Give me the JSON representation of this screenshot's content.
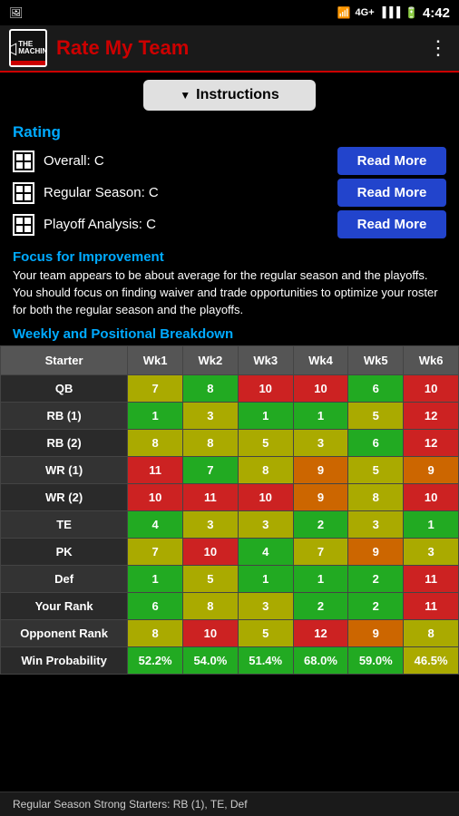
{
  "statusBar": {
    "time": "4:42",
    "wifi": "WiFi",
    "lte": "4G+",
    "battery": "Battery"
  },
  "header": {
    "logoLine1": "THE",
    "logoLine2": "MACHINE",
    "title": "Rate My Team",
    "menuIcon": "⋮"
  },
  "instructions": {
    "label": "Instructions",
    "arrow": "▼"
  },
  "rating": {
    "title": "Rating",
    "rows": [
      {
        "label": "Overall: C",
        "btnLabel": "Read More"
      },
      {
        "label": "Regular Season: C",
        "btnLabel": "Read More"
      },
      {
        "label": "Playoff Analysis: C",
        "btnLabel": "Read More"
      }
    ]
  },
  "focus": {
    "title": "Focus for Improvement",
    "text": "Your team appears to be about average for the regular season and the playoffs. You should focus on finding waiver and trade opportunities to optimize your roster for both the regular season and the playoffs."
  },
  "breakdown": {
    "title": "Weekly and Positional Breakdown"
  },
  "table": {
    "headers": [
      "Starter",
      "Wk1",
      "Wk2",
      "Wk3",
      "Wk4",
      "Wk5",
      "Wk6"
    ],
    "rows": [
      {
        "pos": "QB",
        "vals": [
          "7",
          "8",
          "10",
          "10",
          "6",
          "10"
        ],
        "colors": [
          "yellow",
          "green",
          "red",
          "red",
          "green",
          "red"
        ]
      },
      {
        "pos": "RB (1)",
        "vals": [
          "1",
          "3",
          "1",
          "1",
          "5",
          "12"
        ],
        "colors": [
          "green",
          "yellow",
          "green",
          "green",
          "yellow",
          "red"
        ]
      },
      {
        "pos": "RB (2)",
        "vals": [
          "8",
          "8",
          "5",
          "3",
          "6",
          "12"
        ],
        "colors": [
          "yellow",
          "yellow",
          "yellow",
          "yellow",
          "green",
          "red"
        ]
      },
      {
        "pos": "WR (1)",
        "vals": [
          "11",
          "7",
          "8",
          "9",
          "5",
          "9"
        ],
        "colors": [
          "red",
          "green",
          "yellow",
          "orange",
          "yellow",
          "orange"
        ]
      },
      {
        "pos": "WR (2)",
        "vals": [
          "10",
          "11",
          "10",
          "9",
          "8",
          "10"
        ],
        "colors": [
          "red",
          "red",
          "red",
          "orange",
          "yellow",
          "red"
        ]
      },
      {
        "pos": "TE",
        "vals": [
          "4",
          "3",
          "3",
          "2",
          "3",
          "1"
        ],
        "colors": [
          "green",
          "yellow",
          "yellow",
          "green",
          "yellow",
          "green"
        ]
      },
      {
        "pos": "PK",
        "vals": [
          "7",
          "10",
          "4",
          "7",
          "9",
          "3"
        ],
        "colors": [
          "yellow",
          "red",
          "green",
          "yellow",
          "orange",
          "yellow"
        ]
      },
      {
        "pos": "Def",
        "vals": [
          "1",
          "5",
          "1",
          "1",
          "2",
          "11"
        ],
        "colors": [
          "green",
          "yellow",
          "green",
          "green",
          "green",
          "red"
        ]
      },
      {
        "pos": "Your Rank",
        "vals": [
          "6",
          "8",
          "3",
          "2",
          "2",
          "11"
        ],
        "colors": [
          "green",
          "yellow",
          "yellow",
          "green",
          "green",
          "red"
        ]
      },
      {
        "pos": "Opponent Rank",
        "vals": [
          "8",
          "10",
          "5",
          "12",
          "9",
          "8"
        ],
        "colors": [
          "yellow",
          "red",
          "yellow",
          "red",
          "orange",
          "yellow"
        ]
      },
      {
        "pos": "Win Probability",
        "vals": [
          "52.2%",
          "54.0%",
          "51.4%",
          "68.0%",
          "59.0%",
          "46.5%"
        ],
        "colors": [
          "green",
          "green",
          "green",
          "green",
          "green",
          "yellow"
        ]
      }
    ]
  },
  "bottomBar": {
    "text": "Regular Season Strong Starters: RB (1), TE, Def"
  }
}
